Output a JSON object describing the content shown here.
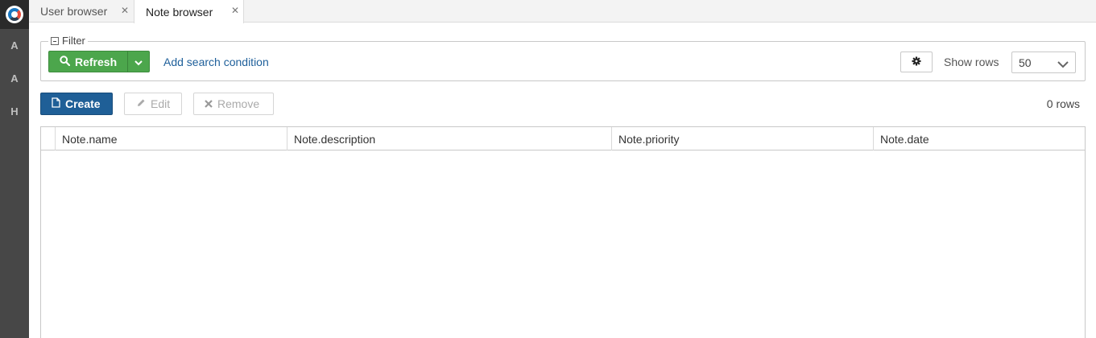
{
  "tabs": [
    {
      "label": "User browser",
      "active": false
    },
    {
      "label": "Note browser",
      "active": true
    }
  ],
  "sidebar": {
    "items": [
      "A",
      "A",
      "H"
    ]
  },
  "filter": {
    "legend": "Filter",
    "refresh_label": "Refresh",
    "add_condition_label": "Add search condition",
    "show_rows_label": "Show rows",
    "rows_value": "50"
  },
  "actions": {
    "create_label": "Create",
    "edit_label": "Edit",
    "remove_label": "Remove",
    "row_count": "0 rows"
  },
  "table": {
    "columns": [
      "Note.name",
      "Note.description",
      "Note.priority",
      "Note.date"
    ],
    "rows": []
  },
  "colors": {
    "refresh_green": "#4ca64c",
    "create_blue": "#1f5f97",
    "link_blue": "#1e5f9a",
    "sidebar_bg": "#474747"
  }
}
